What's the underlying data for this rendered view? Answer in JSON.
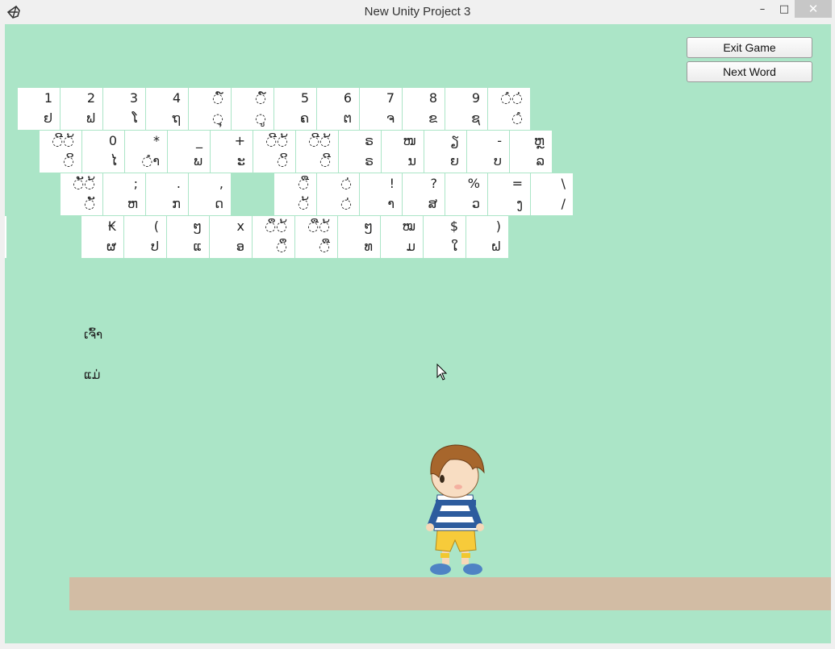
{
  "window": {
    "title": "New Unity Project 3",
    "minimize_glyph": "–",
    "maximize_glyph": "□",
    "close_glyph": "✕"
  },
  "buttons": {
    "exit_game": "Exit Game",
    "next_word": "Next Word"
  },
  "keyboard": {
    "rows": [
      [
        {
          "top": "1",
          "bottom": "ຢ"
        },
        {
          "top": "2",
          "bottom": "ຟ"
        },
        {
          "top": "3",
          "bottom": "ໂ"
        },
        {
          "top": "4",
          "bottom": "ຖ"
        },
        {
          "top": "◌໌",
          "bottom": "◌ຸ"
        },
        {
          "top": "◌໌",
          "bottom": "◌ູ"
        },
        {
          "top": "5",
          "bottom": "ຄ"
        },
        {
          "top": "6",
          "bottom": "ຕ"
        },
        {
          "top": "7",
          "bottom": "ຈ"
        },
        {
          "top": "8",
          "bottom": "ຂ"
        },
        {
          "top": "9",
          "bottom": "ຊ"
        },
        {
          "top": "◌ໍ◌່",
          "bottom": "◌ໍ"
        }
      ],
      [
        {
          "top": "◌ີ◌້",
          "bottom": "◌ິ"
        },
        {
          "top": "0",
          "bottom": "ໄ"
        },
        {
          "top": "*",
          "bottom": "◌ຳ"
        },
        {
          "top": "_",
          "bottom": "ພ"
        },
        {
          "top": "+",
          "bottom": "ະ"
        },
        {
          "top": "◌ີ◌້",
          "bottom": "◌ິ"
        },
        {
          "top": "◌ີ◌້",
          "bottom": "◌ີ"
        },
        {
          "top": "ຣ",
          "bottom": "ຣ"
        },
        {
          "top": "ໜ",
          "bottom": "ນ"
        },
        {
          "top": "ຽ",
          "bottom": "ຍ"
        },
        {
          "top": "-",
          "bottom": "ບ"
        },
        {
          "top": "ຫຼ",
          "bottom": "ລ"
        }
      ],
      [
        {
          "top": "◌ັ◌້",
          "bottom": "◌ັ"
        },
        {
          "top": ";",
          "bottom": "ຫ"
        },
        {
          "top": ".",
          "bottom": "ກ"
        },
        {
          "top": ",",
          "bottom": "ດ"
        },
        {
          "top": "",
          "bottom": "",
          "gap": true
        },
        {
          "top": "◌ື",
          "bottom": "◌້"
        },
        {
          "top": "◌່",
          "bottom": "◌່"
        },
        {
          "top": "!",
          "bottom": "າ"
        },
        {
          "top": "?",
          "bottom": "ສ"
        },
        {
          "top": "%",
          "bottom": "ວ"
        },
        {
          "top": "=",
          "bottom": "ງ"
        },
        {
          "top": "\\",
          "bottom": "/"
        }
      ],
      [
        {
          "top": "₭",
          "bottom": "ຜ"
        },
        {
          "top": "(",
          "bottom": "ປ"
        },
        {
          "top": "ໆ",
          "bottom": "ແ"
        },
        {
          "top": "x",
          "bottom": "ອ"
        },
        {
          "top": "◌ຶ◌້",
          "bottom": "◌ຶ"
        },
        {
          "top": "◌ື◌້",
          "bottom": "◌ື"
        },
        {
          "top": "ໆ",
          "bottom": "ທ"
        },
        {
          "top": "ໝ",
          "bottom": "ມ"
        },
        {
          "top": "$",
          "bottom": "ໃ"
        },
        {
          "top": ")",
          "bottom": "ຝ"
        }
      ]
    ]
  },
  "words": {
    "word1": "ເຈົ້າ",
    "word2": "ແມ່"
  },
  "colors": {
    "background": "#abe5c7",
    "ground": "#d2bca4",
    "key": "#ffffff"
  }
}
